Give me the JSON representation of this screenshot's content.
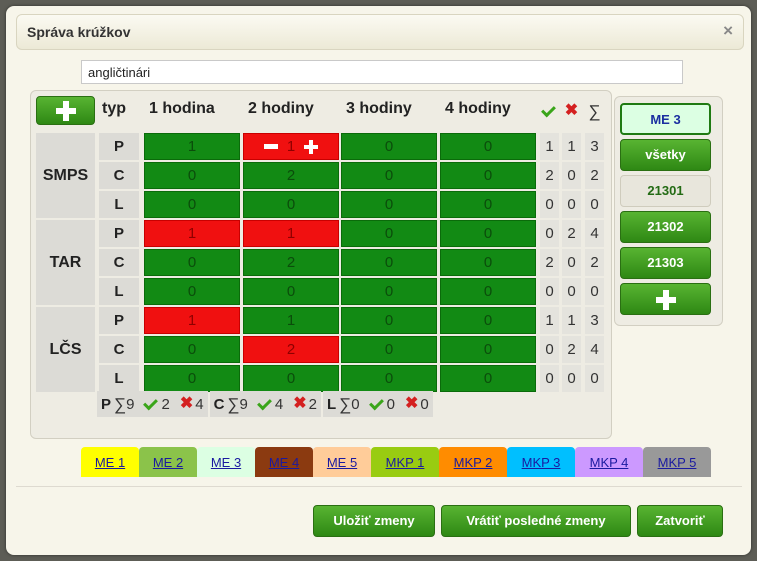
{
  "dialog": {
    "title": "Správa krúžkov",
    "close_glyph": "×"
  },
  "name_input": {
    "value": "angličtinári"
  },
  "grid": {
    "type_header": "typ",
    "hour_headers": [
      "1 hodina",
      "2 hodiny",
      "3 hodiny",
      "4 hodiny"
    ],
    "groups": [
      {
        "name": "SMPS",
        "rows": [
          {
            "type": "P",
            "cells": [
              {
                "v": "1",
                "red": false
              },
              {
                "v": "1",
                "red": true,
                "editing": true
              },
              {
                "v": "0",
                "red": false
              },
              {
                "v": "0",
                "red": false
              }
            ],
            "stats": [
              "1",
              "1",
              "3"
            ]
          },
          {
            "type": "C",
            "cells": [
              {
                "v": "0",
                "red": false
              },
              {
                "v": "2",
                "red": false
              },
              {
                "v": "0",
                "red": false
              },
              {
                "v": "0",
                "red": false
              }
            ],
            "stats": [
              "2",
              "0",
              "2"
            ]
          },
          {
            "type": "L",
            "cells": [
              {
                "v": "0",
                "red": false
              },
              {
                "v": "0",
                "red": false
              },
              {
                "v": "0",
                "red": false
              },
              {
                "v": "0",
                "red": false
              }
            ],
            "stats": [
              "0",
              "0",
              "0"
            ]
          }
        ]
      },
      {
        "name": "TAR",
        "rows": [
          {
            "type": "P",
            "cells": [
              {
                "v": "1",
                "red": true
              },
              {
                "v": "1",
                "red": true
              },
              {
                "v": "0",
                "red": false
              },
              {
                "v": "0",
                "red": false
              }
            ],
            "stats": [
              "0",
              "2",
              "4"
            ]
          },
          {
            "type": "C",
            "cells": [
              {
                "v": "0",
                "red": false
              },
              {
                "v": "2",
                "red": false
              },
              {
                "v": "0",
                "red": false
              },
              {
                "v": "0",
                "red": false
              }
            ],
            "stats": [
              "2",
              "0",
              "2"
            ]
          },
          {
            "type": "L",
            "cells": [
              {
                "v": "0",
                "red": false
              },
              {
                "v": "0",
                "red": false
              },
              {
                "v": "0",
                "red": false
              },
              {
                "v": "0",
                "red": false
              }
            ],
            "stats": [
              "0",
              "0",
              "0"
            ]
          }
        ]
      },
      {
        "name": "LČS",
        "rows": [
          {
            "type": "P",
            "cells": [
              {
                "v": "1",
                "red": true
              },
              {
                "v": "1",
                "red": false
              },
              {
                "v": "0",
                "red": false
              },
              {
                "v": "0",
                "red": false
              }
            ],
            "stats": [
              "1",
              "1",
              "3"
            ]
          },
          {
            "type": "C",
            "cells": [
              {
                "v": "0",
                "red": false
              },
              {
                "v": "2",
                "red": true
              },
              {
                "v": "0",
                "red": false
              },
              {
                "v": "0",
                "red": false
              }
            ],
            "stats": [
              "0",
              "2",
              "4"
            ]
          },
          {
            "type": "L",
            "cells": [
              {
                "v": "0",
                "red": false
              },
              {
                "v": "0",
                "red": false
              },
              {
                "v": "0",
                "red": false
              },
              {
                "v": "0",
                "red": false
              }
            ],
            "stats": [
              "0",
              "0",
              "0"
            ]
          }
        ]
      }
    ],
    "summary": [
      {
        "type": "P",
        "sum": "9",
        "ok": "2",
        "bad": "4"
      },
      {
        "type": "C",
        "sum": "9",
        "ok": "4",
        "bad": "2"
      },
      {
        "type": "L",
        "sum": "0",
        "ok": "0",
        "bad": "0"
      }
    ]
  },
  "side_buttons": [
    {
      "label": "ME 3",
      "style": "selected"
    },
    {
      "label": "všetky",
      "style": "green"
    },
    {
      "label": "21301",
      "style": "plain"
    },
    {
      "label": "21302",
      "style": "green"
    },
    {
      "label": "21303",
      "style": "green"
    },
    {
      "label": "",
      "style": "add",
      "icon": "plus-icon"
    }
  ],
  "tabs": [
    {
      "label": "ME 1",
      "color": "#ffff00",
      "active": false
    },
    {
      "label": "ME 2",
      "color": "#8bc34a",
      "active": false
    },
    {
      "label": "ME 3",
      "color": "#dcffe3",
      "active": true
    },
    {
      "label": "ME 4",
      "color": "#8b3a10",
      "active": false
    },
    {
      "label": "ME 5",
      "color": "#ffcc99",
      "active": false
    },
    {
      "label": "MKP 1",
      "color": "#99cc11",
      "active": false
    },
    {
      "label": "MKP 2",
      "color": "#ff8c00",
      "active": false
    },
    {
      "label": "MKP 3",
      "color": "#00bfff",
      "active": false
    },
    {
      "label": "MKP 4",
      "color": "#cc99ff",
      "active": false
    },
    {
      "label": "MKP 5",
      "color": "#999999",
      "active": false
    }
  ],
  "footer": {
    "save": "Uložiť zmeny",
    "revert": "Vrátiť posledné zmeny",
    "close": "Zatvoriť"
  },
  "colors": {
    "ok_green": "#128a14",
    "bad_red": "#f01010",
    "button_green": "#3d9a1f"
  }
}
